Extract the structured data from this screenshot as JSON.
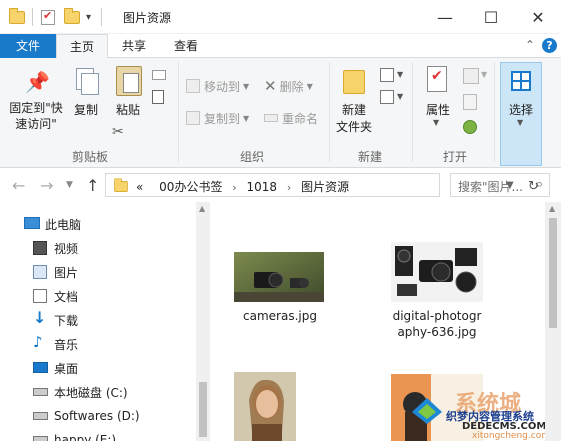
{
  "window": {
    "title": "图片资源",
    "minimize_glyph": "—",
    "maximize_glyph": "☐",
    "close_glyph": "✕"
  },
  "quick_access_dropdown": "▾",
  "tabs": {
    "file": "文件",
    "home": "主页",
    "share": "共享",
    "view": "查看"
  },
  "ribbon": {
    "clipboard": {
      "pin_label_1": "固定到\"快",
      "pin_label_2": "速访问\"",
      "copy_label": "复制",
      "paste_label": "粘贴",
      "group_label": "剪贴板"
    },
    "organize": {
      "move_to": "移动到",
      "copy_to": "复制到",
      "delete": "删除",
      "rename": "重命名",
      "group_label": "组织"
    },
    "new": {
      "new_folder_1": "新建",
      "new_folder_2": "文件夹",
      "group_label": "新建"
    },
    "open": {
      "properties": "属性",
      "group_label": "打开"
    },
    "select": {
      "label": "选择"
    }
  },
  "address": {
    "overflow": "«",
    "crumbs": [
      "00办公书签",
      "1018",
      "图片资源"
    ],
    "search_placeholder": "搜索\"图片..."
  },
  "nav": {
    "items": [
      {
        "label": "此电脑",
        "icon": "computer-icon"
      },
      {
        "label": "视频",
        "icon": "video-icon"
      },
      {
        "label": "图片",
        "icon": "pictures-icon"
      },
      {
        "label": "文档",
        "icon": "documents-icon"
      },
      {
        "label": "下载",
        "icon": "download-icon"
      },
      {
        "label": "音乐",
        "icon": "music-icon"
      },
      {
        "label": "桌面",
        "icon": "desktop-icon"
      },
      {
        "label": "本地磁盘 (C:)",
        "icon": "drive-icon"
      },
      {
        "label": "Softwares (D:)",
        "icon": "drive-icon"
      },
      {
        "label": "happy (E:)",
        "icon": "drive-icon"
      }
    ]
  },
  "files": [
    {
      "name_1": "cameras.jpg",
      "name_2": ""
    },
    {
      "name_1": "digital-photogr",
      "name_2": "aphy-636.jpg"
    },
    {
      "name_1": "",
      "name_2": ""
    },
    {
      "name_1": "",
      "name_2": ""
    }
  ],
  "watermark": {
    "line1": "系统城",
    "line2": "织梦内容管理系统",
    "line3": "DEDECMS.COM",
    "line4": "xitongcheng.com"
  },
  "colors": {
    "accent": "#1979ca",
    "ribbon_bg": "#f5f6f7",
    "select_bg": "#cde6f7"
  }
}
